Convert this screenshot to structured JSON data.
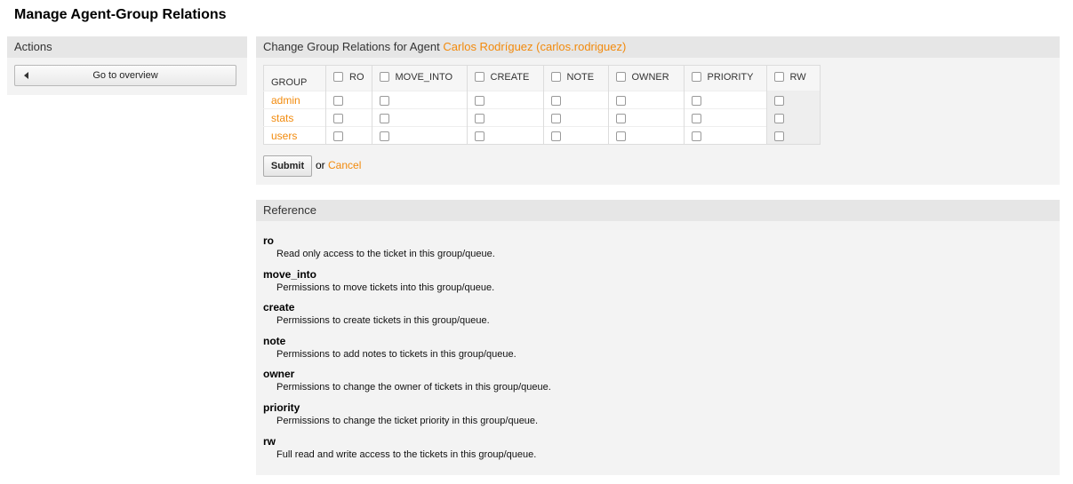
{
  "page": {
    "title": "Manage Agent-Group Relations"
  },
  "sidebar": {
    "header": "Actions",
    "overview_button": "Go to overview"
  },
  "relations": {
    "header_prefix": "Change Group Relations for Agent",
    "agent": "Carlos Rodríguez (carlos.rodriguez)",
    "columns": {
      "group": "GROUP",
      "ro": "RO",
      "move_into": "MOVE_INTO",
      "create": "CREATE",
      "note": "NOTE",
      "owner": "OWNER",
      "priority": "PRIORITY",
      "rw": "RW"
    },
    "groups": [
      "admin",
      "stats",
      "users"
    ],
    "submit_label": "Submit",
    "or_text": "or",
    "cancel_label": "Cancel"
  },
  "reference": {
    "header": "Reference",
    "items": [
      {
        "term": "ro",
        "desc": "Read only access to the ticket in this group/queue."
      },
      {
        "term": "move_into",
        "desc": "Permissions to move tickets into this group/queue."
      },
      {
        "term": "create",
        "desc": "Permissions to create tickets in this group/queue."
      },
      {
        "term": "note",
        "desc": "Permissions to add notes to tickets in this group/queue."
      },
      {
        "term": "owner",
        "desc": "Permissions to change the owner of tickets in this group/queue."
      },
      {
        "term": "priority",
        "desc": "Permissions to change the ticket priority in this group/queue."
      },
      {
        "term": "rw",
        "desc": "Full read and write access to the tickets in this group/queue."
      }
    ]
  },
  "colors": {
    "link": "#f28a0c",
    "header_bg": "#e6e6e6",
    "panel_bg": "#f3f3f3"
  },
  "icons": {
    "overview_button_icon": "triangle-left-icon"
  }
}
